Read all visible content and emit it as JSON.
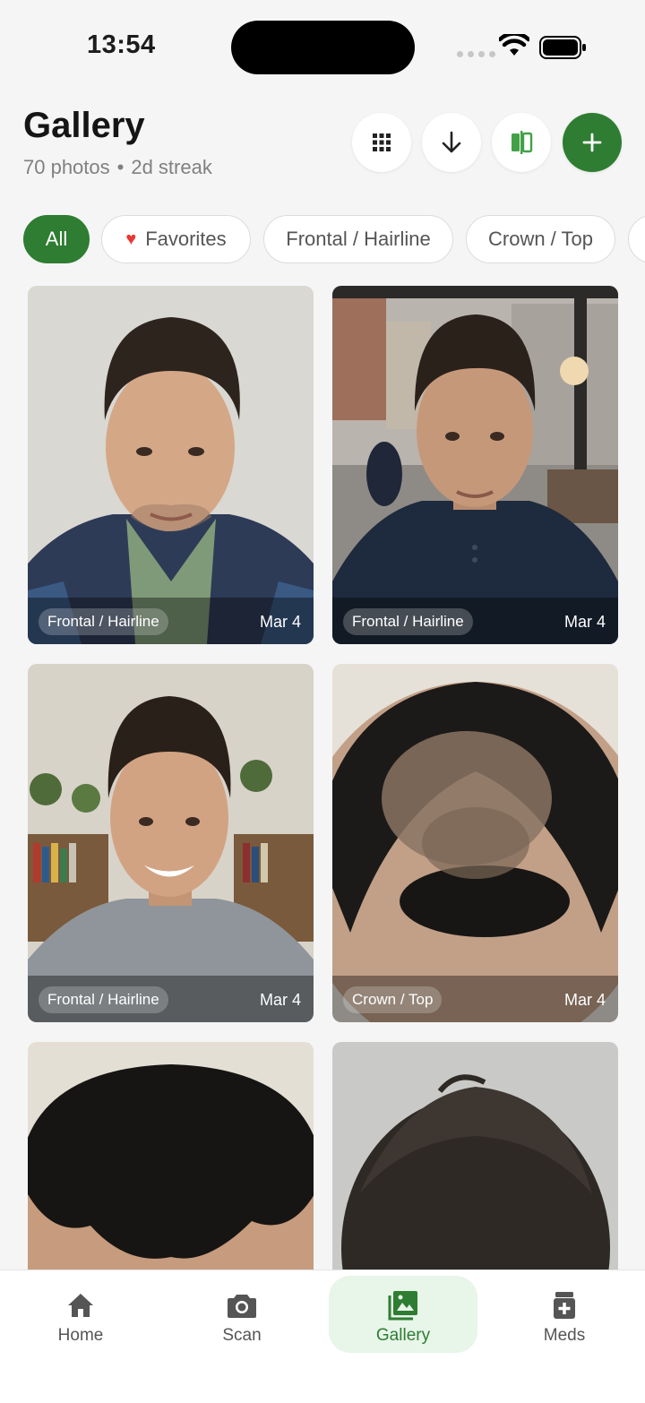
{
  "status_bar": {
    "time": "13:54"
  },
  "header": {
    "title": "Gallery",
    "photo_count": "70 photos",
    "separator": "•",
    "streak": "2d streak",
    "buttons": [
      {
        "name": "grid-view-button",
        "icon": "grid-icon"
      },
      {
        "name": "sort-button",
        "icon": "arrow-down-icon"
      },
      {
        "name": "compare-button",
        "icon": "compare-icon"
      },
      {
        "name": "add-photo-button",
        "icon": "plus-icon"
      }
    ]
  },
  "filters": [
    {
      "label": "All",
      "active": true
    },
    {
      "label": "Favorites",
      "icon": "heart-icon"
    },
    {
      "label": "Frontal / Hairline"
    },
    {
      "label": "Crown / Top"
    }
  ],
  "photos": [
    {
      "tag": "Frontal / Hairline",
      "date": "Mar 4"
    },
    {
      "tag": "Frontal / Hairline",
      "date": "Mar 4"
    },
    {
      "tag": "Frontal / Hairline",
      "date": "Mar 4"
    },
    {
      "tag": "Crown / Top",
      "date": "Mar 4"
    },
    {
      "tag": "",
      "date": ""
    },
    {
      "tag": "",
      "date": ""
    }
  ],
  "bottom_nav": [
    {
      "label": "Home",
      "icon": "home-icon"
    },
    {
      "label": "Scan",
      "icon": "camera-icon"
    },
    {
      "label": "Gallery",
      "icon": "gallery-icon",
      "active": true
    },
    {
      "label": "Meds",
      "icon": "meds-icon"
    }
  ],
  "colors": {
    "accent": "#2e7d32",
    "accent_light": "#e8f5e9",
    "favorite": "#e53935"
  }
}
